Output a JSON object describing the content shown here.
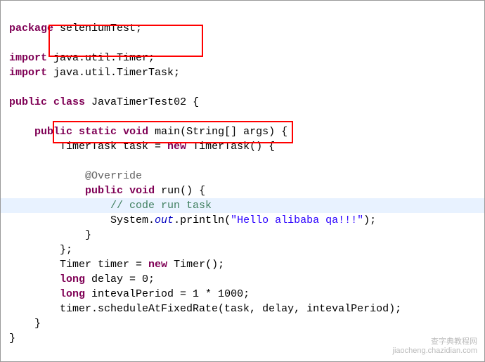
{
  "package_kw": "package",
  "package_name": " seleniumTest;",
  "import_kw": "import",
  "import1": " java.util.Timer;",
  "import2": " java.util.TimerTask;",
  "public_kw": "public",
  "class_kw": "class",
  "class_name": " JavaTimerTest02 {",
  "static_kw": "static",
  "void_kw": "void",
  "main_sig": " main(String[] args) {",
  "timertask_decl": "TimerTask task = ",
  "new_kw": "new",
  "timertask_ctor": " TimerTask() {",
  "override": "@Override",
  "run_sig": " run() {",
  "comment_run": "// code run task",
  "system": "System.",
  "out": "out",
  "println_open": ".println(",
  "hello_str": "\"Hello alibaba qa!!!\"",
  "println_close": ");",
  "close_brace": "}",
  "close_anon": "};",
  "timer_decl1": "Timer timer = ",
  "timer_ctor": " Timer();",
  "long_kw": "long",
  "delay_decl": " delay = 0;",
  "interval_decl": " intevalPeriod = 1 * 1000;",
  "schedule": "timer.scheduleAtFixedRate(task, delay, intevalPeriod);",
  "watermark1": "查字典教程网",
  "watermark2": "jiaocheng.chazidian.com"
}
